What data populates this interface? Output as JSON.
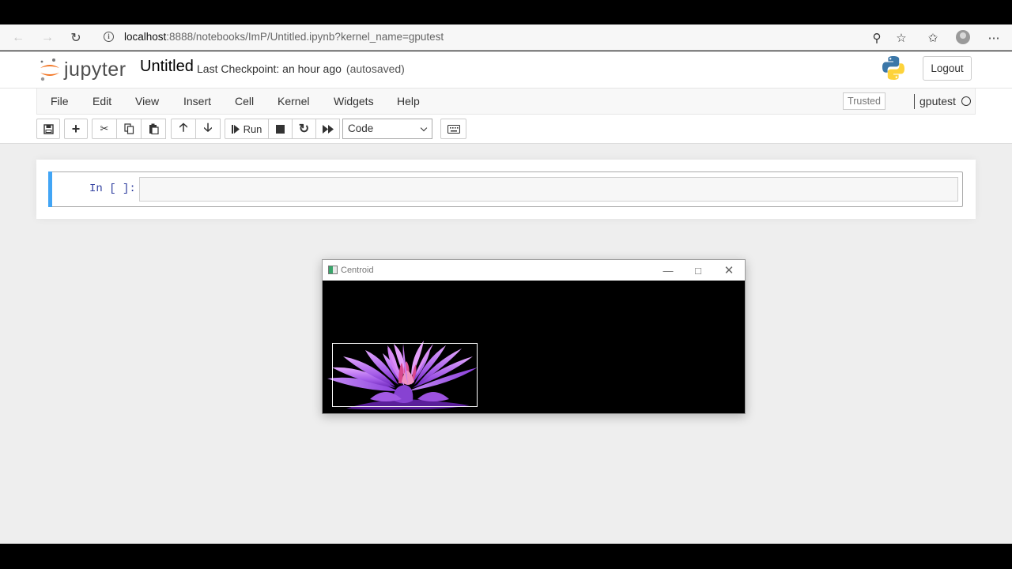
{
  "browser": {
    "url_host": "localhost",
    "url_rest": ":8888/notebooks/ImP/Untitled.ipynb?kernel_name=gputest",
    "icons": [
      "back-arrow-icon",
      "forward-arrow-icon",
      "refresh-icon",
      "info-icon",
      "zoom-icon",
      "star-icon",
      "favorites-icon",
      "profile-icon",
      "more-icon"
    ]
  },
  "header": {
    "logo_text": "jupyter",
    "notebook_name": "Untitled",
    "checkpoint": "Last Checkpoint: an hour ago",
    "autosave": "(autosaved)",
    "logout_label": "Logout"
  },
  "menubar": {
    "items": [
      "File",
      "Edit",
      "View",
      "Insert",
      "Cell",
      "Kernel",
      "Widgets",
      "Help"
    ],
    "trusted_label": "Trusted",
    "kernel_name": "gputest"
  },
  "toolbar": {
    "run_label": "Run",
    "cell_type": "Code"
  },
  "cell": {
    "prompt": "In [ ]:",
    "code": ""
  },
  "cv_window": {
    "title": "Centroid"
  },
  "colors": {
    "cell_selected_bar": "#42a5f5",
    "jupyter_orange": "#f37726",
    "prompt_blue": "#303f9f",
    "lotus_purple": "#a45ce8"
  }
}
